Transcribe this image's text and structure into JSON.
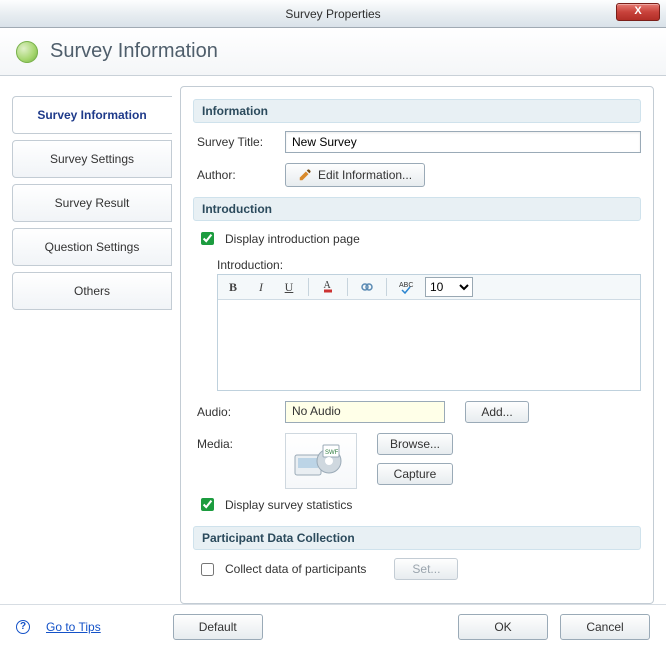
{
  "titlebar": {
    "title": "Survey Properties",
    "close": "X"
  },
  "header": {
    "title": "Survey Information"
  },
  "tabs": [
    {
      "label": "Survey Information",
      "active": true
    },
    {
      "label": "Survey Settings"
    },
    {
      "label": "Survey Result"
    },
    {
      "label": "Question Settings"
    },
    {
      "label": "Others"
    }
  ],
  "sections": {
    "information": {
      "title": "Information",
      "survey_title_label": "Survey Title:",
      "survey_title_value": "New Survey",
      "author_label": "Author:",
      "edit_info_label": "Edit Information..."
    },
    "introduction": {
      "title": "Introduction",
      "display_intro_label": "Display introduction page",
      "display_intro_checked": true,
      "intro_label": "Introduction:",
      "font_size": "10",
      "editor_value": "",
      "audio_label": "Audio:",
      "audio_value": "No Audio",
      "add_label": "Add...",
      "media_label": "Media:",
      "browse_label": "Browse...",
      "capture_label": "Capture",
      "display_stats_label": "Display survey statistics",
      "display_stats_checked": true
    },
    "participant": {
      "title": "Participant Data Collection",
      "collect_label": "Collect data of participants",
      "collect_checked": false,
      "set_label": "Set..."
    }
  },
  "bottom": {
    "tips_label": "Go to Tips",
    "default_label": "Default",
    "ok_label": "OK",
    "cancel_label": "Cancel"
  }
}
